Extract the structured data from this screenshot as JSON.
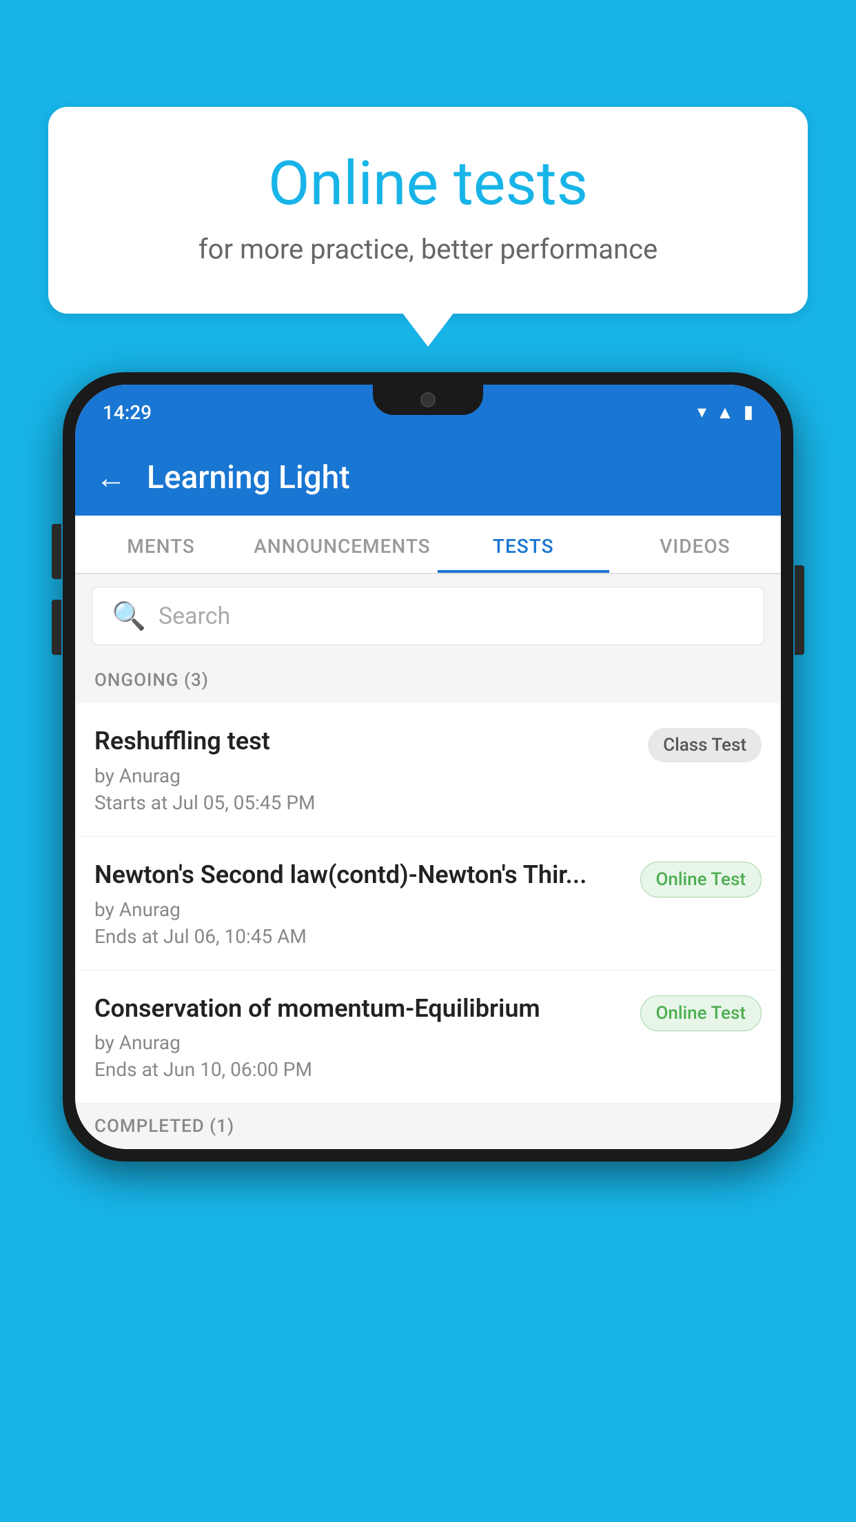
{
  "background_color": "#18b4e8",
  "speech_bubble": {
    "title": "Online tests",
    "subtitle": "for more practice, better performance"
  },
  "phone": {
    "time": "14:29",
    "app_bar": {
      "title": "Learning Light",
      "back_label": "←"
    },
    "tabs": [
      {
        "label": "MENTS",
        "active": false
      },
      {
        "label": "ANNOUNCEMENTS",
        "active": false
      },
      {
        "label": "TESTS",
        "active": true
      },
      {
        "label": "VIDEOS",
        "active": false
      }
    ],
    "search": {
      "placeholder": "Search"
    },
    "ongoing_section": {
      "label": "ONGOING (3)"
    },
    "tests": [
      {
        "title": "Reshuffling test",
        "author": "by Anurag",
        "time": "Starts at  Jul 05, 05:45 PM",
        "badge": "Class Test",
        "badge_type": "class"
      },
      {
        "title": "Newton's Second law(contd)-Newton's Thir...",
        "author": "by Anurag",
        "time": "Ends at  Jul 06, 10:45 AM",
        "badge": "Online Test",
        "badge_type": "online"
      },
      {
        "title": "Conservation of momentum-Equilibrium",
        "author": "by Anurag",
        "time": "Ends at  Jun 10, 06:00 PM",
        "badge": "Online Test",
        "badge_type": "online"
      }
    ],
    "completed_section": {
      "label": "COMPLETED (1)"
    }
  }
}
